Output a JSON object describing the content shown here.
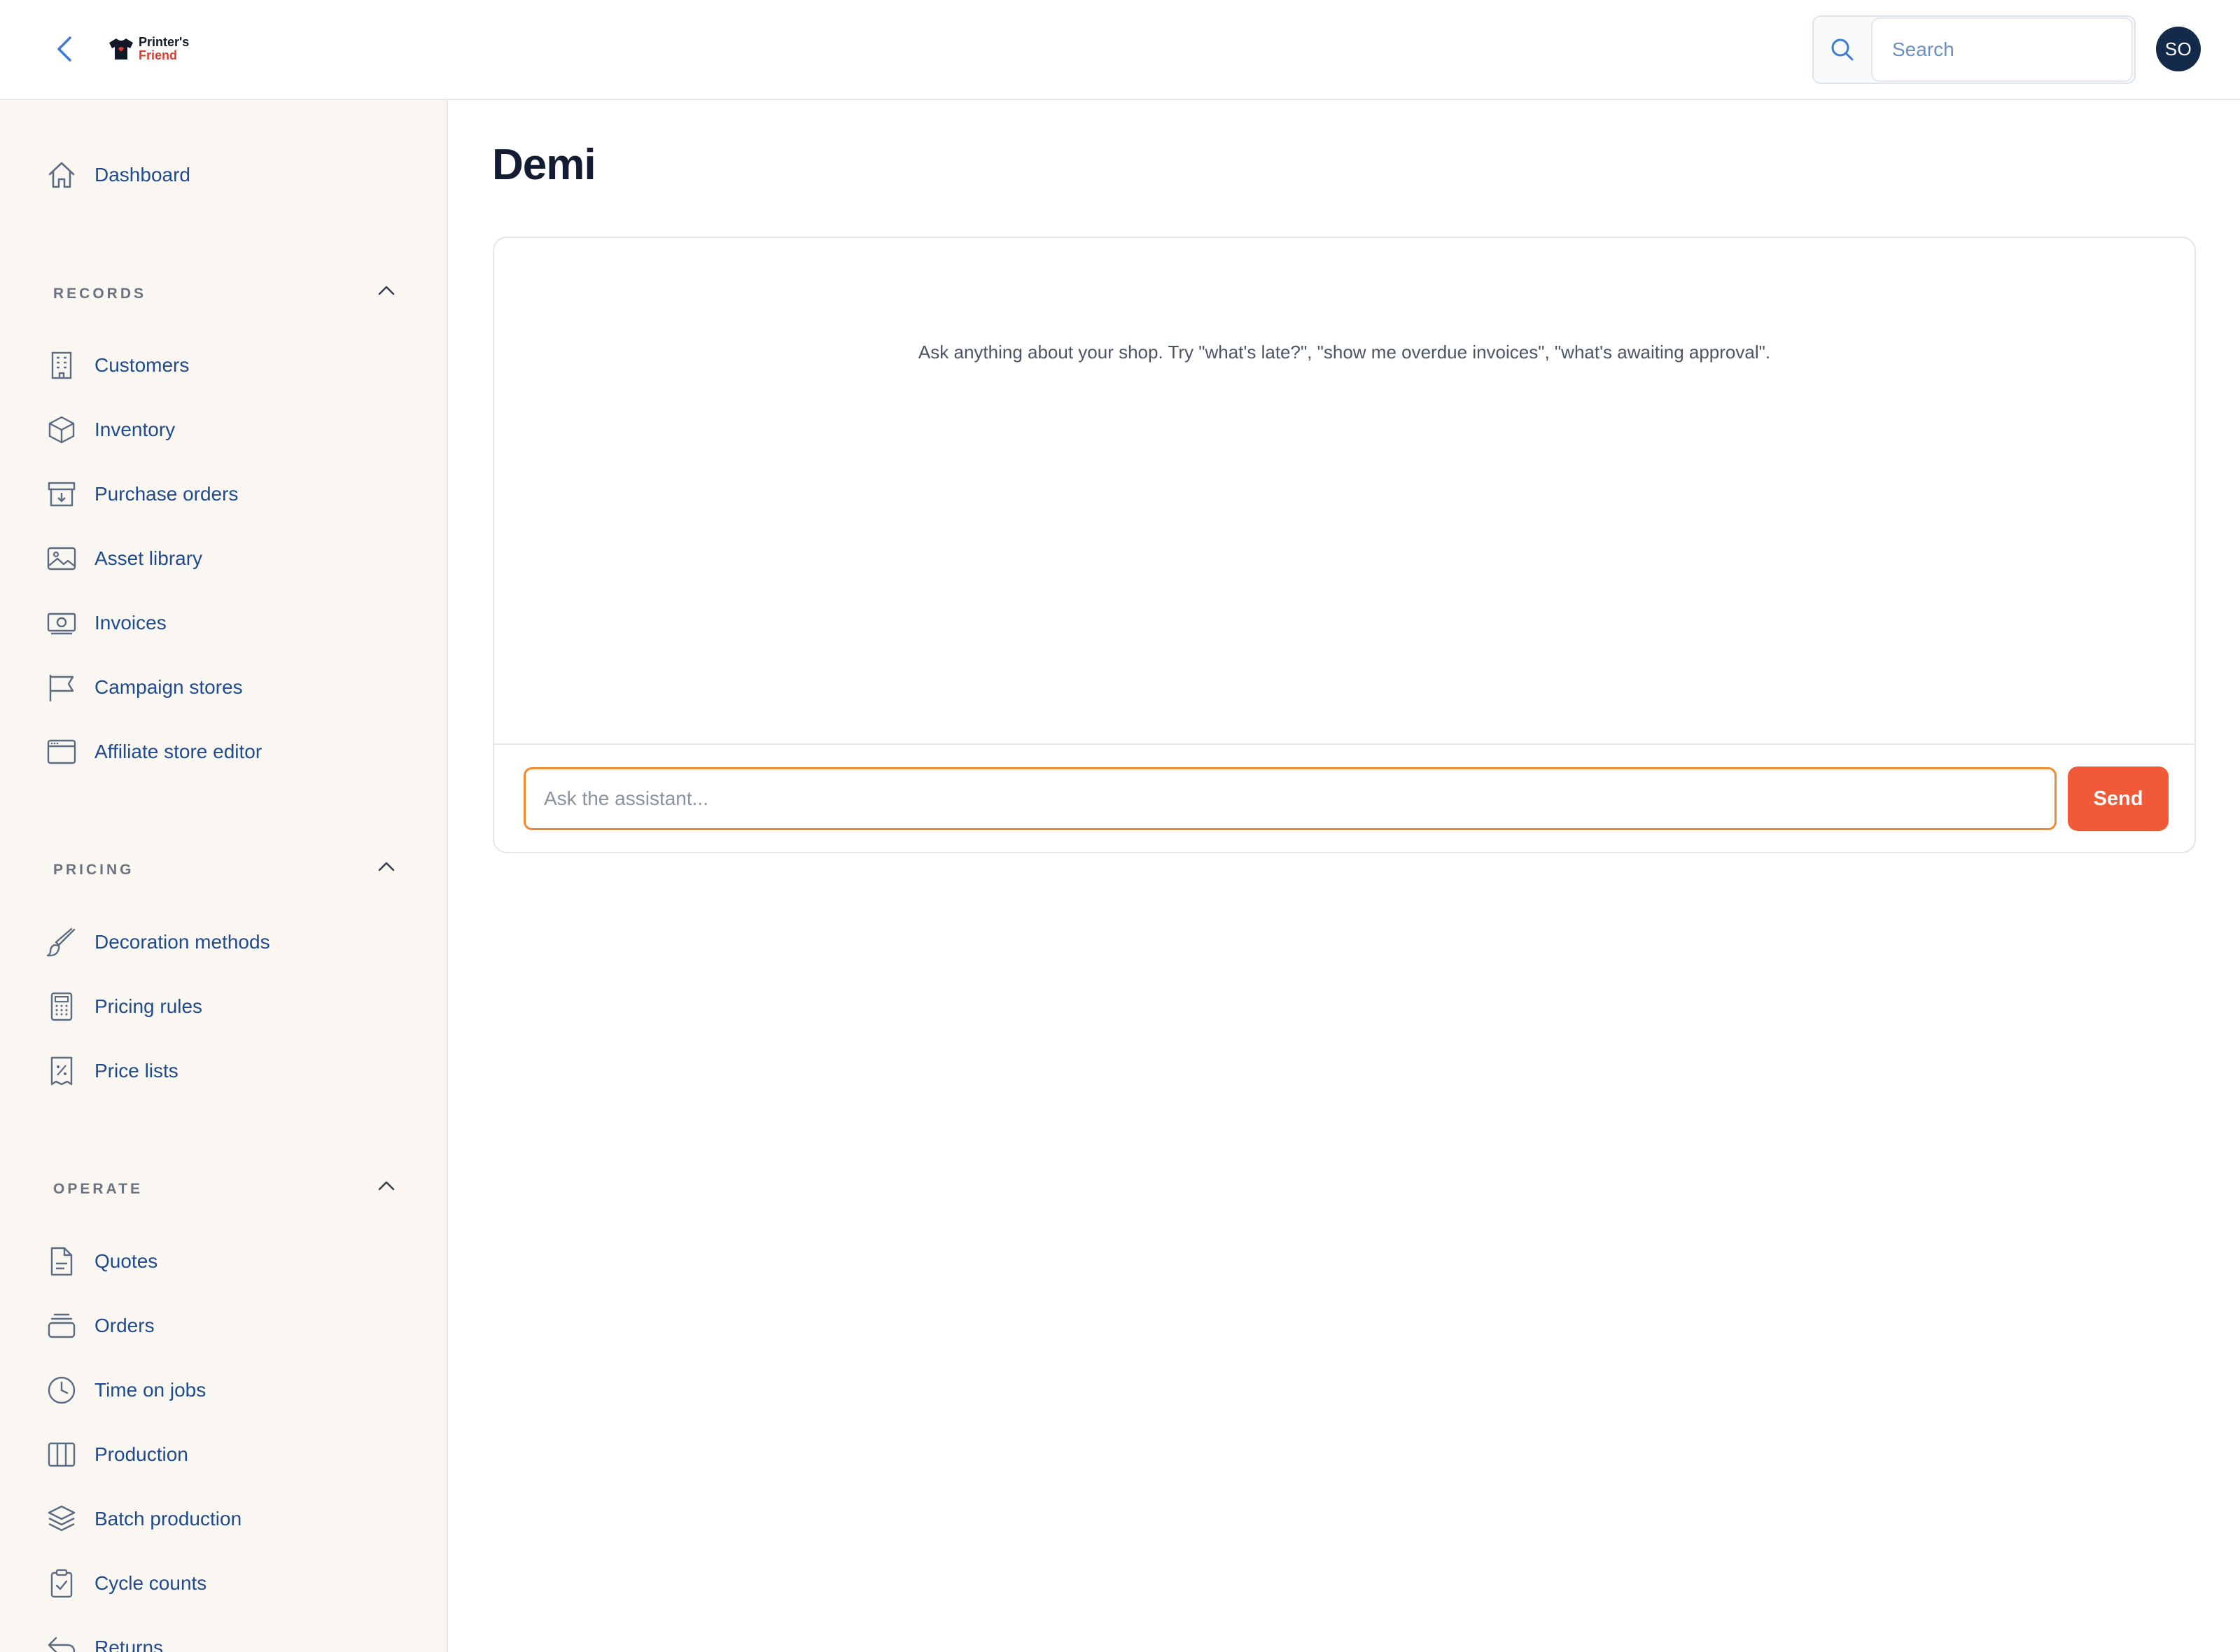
{
  "header": {
    "back_icon": "chevron-left-icon",
    "logo_line1": "Printer's",
    "logo_line2": "Friend",
    "search_placeholder": "Search",
    "avatar_initials": "SO"
  },
  "sidebar": {
    "dashboard": {
      "label": "Dashboard",
      "icon": "home-icon"
    },
    "sections": [
      {
        "label": "RECORDS",
        "items": [
          {
            "label": "Customers",
            "icon": "building-icon"
          },
          {
            "label": "Inventory",
            "icon": "cube-icon"
          },
          {
            "label": "Purchase orders",
            "icon": "archive-download-icon"
          },
          {
            "label": "Asset library",
            "icon": "image-icon"
          },
          {
            "label": "Invoices",
            "icon": "cash-icon"
          },
          {
            "label": "Campaign stores",
            "icon": "flag-icon"
          },
          {
            "label": "Affiliate store editor",
            "icon": "browser-window-icon"
          }
        ]
      },
      {
        "label": "PRICING",
        "items": [
          {
            "label": "Decoration methods",
            "icon": "brush-icon"
          },
          {
            "label": "Pricing rules",
            "icon": "calculator-icon"
          },
          {
            "label": "Price lists",
            "icon": "receipt-percent-icon"
          }
        ]
      },
      {
        "label": "OPERATE",
        "items": [
          {
            "label": "Quotes",
            "icon": "document-icon"
          },
          {
            "label": "Orders",
            "icon": "stack-icon"
          },
          {
            "label": "Time on jobs",
            "icon": "clock-icon"
          },
          {
            "label": "Production",
            "icon": "columns-icon"
          },
          {
            "label": "Batch production",
            "icon": "layers-icon"
          },
          {
            "label": "Cycle counts",
            "icon": "clipboard-check-icon"
          },
          {
            "label": "Returns",
            "icon": "return-arrow-icon"
          }
        ]
      }
    ]
  },
  "main": {
    "title": "Demi",
    "hint": "Ask anything about your shop. Try \"what's late?\", \"show me overdue invoices\", \"what's awaiting approval\".",
    "input_placeholder": "Ask the assistant...",
    "send_label": "Send",
    "accent_color": "#f05a38",
    "focus_color": "#f08a30"
  }
}
